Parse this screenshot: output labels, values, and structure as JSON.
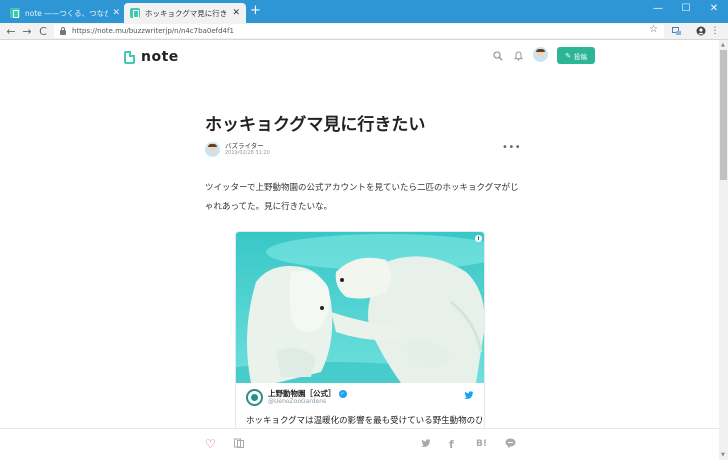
{
  "browser": {
    "tabs": [
      {
        "title": "note ——つくる、つながる、とどける。",
        "close": "✕"
      },
      {
        "title": "ホッキョクグマ見に行きたい｜バズライター",
        "close": "✕"
      }
    ],
    "new_tab": "+",
    "window_controls": [
      "—",
      "☐",
      "✕"
    ],
    "back": "←",
    "forward": "→",
    "reload": "C",
    "url": "https://note.mu/buzzwriterjp/n/n4c7ba0efd4f1",
    "bookmark_star": "☆",
    "menu": "⋮"
  },
  "site": {
    "logo": "note",
    "post_button": "投稿",
    "post_icon": "✎",
    "search_icon": "⌕",
    "bell_icon": "🔔"
  },
  "article": {
    "title": "ホッキョクグマ見に行きたい",
    "author": "バズライター",
    "date": "2019/02/28 31:20",
    "more": "•••",
    "body": "ツイッターで上野動物園の公式アカウントを見ていたら二匹のホッキョクグマがじゃれあってた。見に行きたいな。"
  },
  "tweet": {
    "info": "i",
    "account_name": "上野動物園［公式］",
    "verified": "✓",
    "handle": "@UenoZooGardens",
    "text": "ホッキョクグマは温暖化の影響を最も受けている野生動物のひ"
  },
  "footer": {
    "heart": "♡",
    "magazine": "⊞",
    "twitter": "🐦",
    "facebook": "f",
    "hatena": "B!",
    "line": "◯"
  },
  "colors": {
    "tabbar": "#2f96d6",
    "accent": "#2cb696",
    "heart": "#e6545f",
    "twitter": "#1da1f2"
  }
}
